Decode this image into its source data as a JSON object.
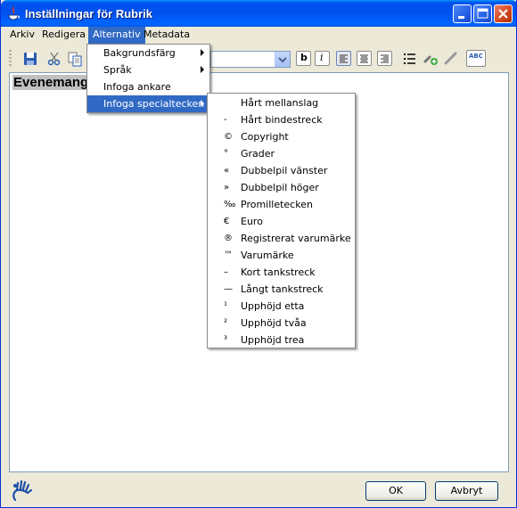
{
  "window": {
    "title": "Inställningar för Rubrik"
  },
  "menubar": [
    "Arkiv",
    "Redigera",
    "Alternativ",
    "Metadata"
  ],
  "alternativ_menu": {
    "items": [
      {
        "label": "Bakgrundsfärg",
        "submenu": true
      },
      {
        "label": "Språk",
        "submenu": true
      },
      {
        "label": "Infoga ankare",
        "submenu": false
      },
      {
        "label": "Infoga specialtecken",
        "submenu": true
      }
    ]
  },
  "specialtecken_menu": {
    "items": [
      {
        "symbol": "",
        "label": "Hårt mellanslag"
      },
      {
        "symbol": "-",
        "label": "Hårt bindestreck"
      },
      {
        "symbol": "©",
        "label": "Copyright"
      },
      {
        "symbol": "°",
        "label": "Grader"
      },
      {
        "symbol": "«",
        "label": "Dubbelpil vänster"
      },
      {
        "symbol": "»",
        "label": "Dubbelpil höger"
      },
      {
        "symbol": "‰",
        "label": "Promilletecken"
      },
      {
        "symbol": "€",
        "label": "Euro"
      },
      {
        "symbol": "®",
        "label": "Registrerat varumärke"
      },
      {
        "symbol": "™",
        "label": "Varumärke"
      },
      {
        "symbol": "–",
        "label": "Kort tankstreck"
      },
      {
        "symbol": "—",
        "label": "Långt tankstreck"
      },
      {
        "symbol": "¹",
        "label": "Upphöjd etta"
      },
      {
        "symbol": "²",
        "label": "Upphöjd tvåa"
      },
      {
        "symbol": "³",
        "label": "Upphöjd trea"
      }
    ]
  },
  "toolbar": {
    "bold_label": "b",
    "italic_label": "i",
    "spellcheck_label": "ABC",
    "icons": [
      "save-icon",
      "cut-icon",
      "copy-icon",
      "bold-icon",
      "italic-icon",
      "align-left-icon",
      "align-center-icon",
      "align-right-icon",
      "bullet-list-icon",
      "insert-link-icon",
      "remove-link-icon",
      "spellcheck-icon"
    ]
  },
  "editor": {
    "text": "Evenemang"
  },
  "buttons": {
    "ok": "OK",
    "cancel": "Avbryt"
  },
  "colors": {
    "title_bar": "#0053ee",
    "highlight": "#316ac5",
    "window_bg": "#ece9d8"
  }
}
